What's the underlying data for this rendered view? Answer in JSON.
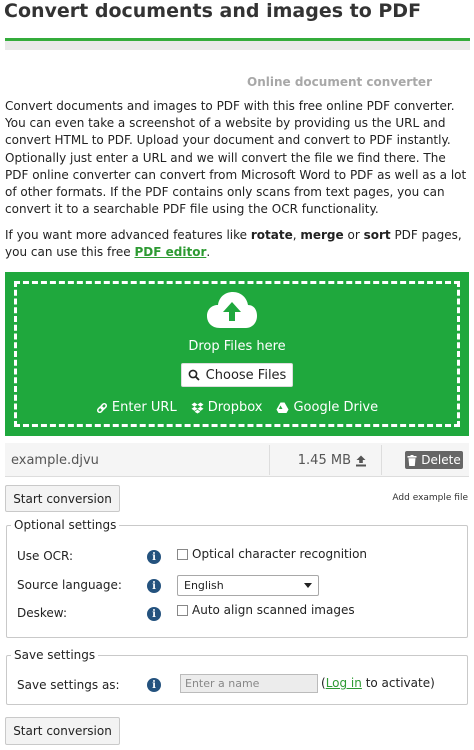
{
  "header": {
    "title": "Convert documents and images to PDF",
    "subtitle": "Online document converter"
  },
  "intro": {
    "paragraph": "Convert documents and images to PDF with this free online PDF converter. You can even take a screenshot of a website by providing us the URL and convert HTML to PDF. Upload your document and convert to PDF instantly. Optionally just enter a URL and we will convert the file we find there. The PDF online converter can convert from Microsoft Word to PDF as well as a lot of other formats. If the PDF contains only scans from text pages, you can convert it to a searchable PDF file using the OCR functionality.",
    "advanced_prefix": "If you want more advanced features like ",
    "rotate": "rotate",
    "comma": ", ",
    "merge": "merge",
    "or": " or ",
    "sort": "sort",
    "advanced_mid": " PDF pages, you can use this free ",
    "editor_link": "PDF editor",
    "period": "."
  },
  "dropzone": {
    "drop_text": "Drop Files here",
    "choose_label": "Choose Files",
    "enter_url": "Enter URL",
    "dropbox": "Dropbox",
    "google_drive": "Google Drive"
  },
  "file": {
    "name": "example.djvu",
    "size": "1.45 MB",
    "delete_label": "Delete"
  },
  "actions": {
    "start_conversion": "Start conversion",
    "add_example": "Add example file"
  },
  "optional_settings": {
    "legend": "Optional settings",
    "ocr_label": "Use OCR:",
    "ocr_check": "Optical character recognition",
    "source_language_label": "Source language:",
    "source_language_value": "English",
    "deskew_label": "Deskew:",
    "deskew_check": "Auto align scanned images"
  },
  "save_settings": {
    "legend": "Save settings",
    "label": "Save settings as:",
    "placeholder": "Enter a name",
    "paren_open": "(",
    "login_link": "Log in",
    "suffix": " to activate)"
  },
  "icons": {
    "info": "i"
  },
  "colors": {
    "accent_green": "#1fa83d",
    "link_green": "#2d9a32",
    "info_blue": "#24527e"
  }
}
